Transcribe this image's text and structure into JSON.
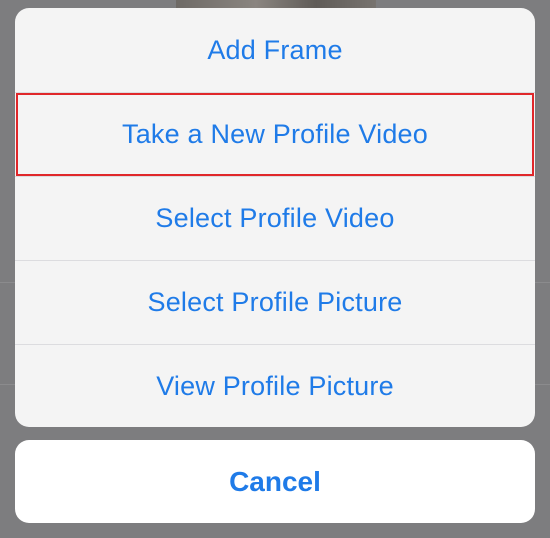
{
  "action_sheet": {
    "actions": [
      {
        "label": "Add Frame"
      },
      {
        "label": "Take a New Profile Video"
      },
      {
        "label": "Select Profile Video"
      },
      {
        "label": "Select Profile Picture"
      },
      {
        "label": "View Profile Picture"
      }
    ],
    "cancel_label": "Cancel",
    "highlighted_action": "Take a New Profile Video"
  },
  "colors": {
    "accent": "#1f7be8",
    "highlight_border": "#e0272a",
    "sheet_background": "#f4f4f4",
    "dimmed_backdrop": "#7d7d7f"
  }
}
